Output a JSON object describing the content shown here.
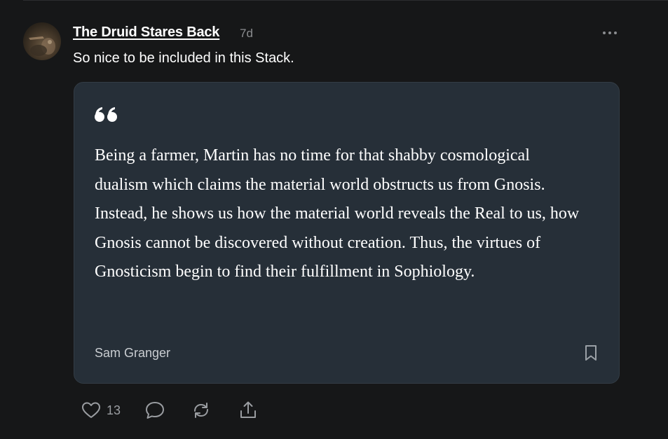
{
  "post": {
    "author": "The Druid Stares Back",
    "timestamp": "7d",
    "text": "So nice to be included in this Stack.",
    "avatar_icon": "avatar-image"
  },
  "quote": {
    "text": "Being a farmer, Martin has no time for that shabby cosmological dualism which claims the material world obstructs us from Gnosis. Instead, he shows us how the material world reveals the Real to us, how Gnosis cannot be discovered without creation. Thus, the virtues of Gnosticism begin to find their fulfillment in Sophiology.",
    "author": "Sam Granger"
  },
  "actions": {
    "like_count": "13",
    "icons": [
      "heart-icon",
      "comment-icon",
      "restack-icon",
      "share-icon"
    ]
  },
  "colors": {
    "background": "#161718",
    "card": "#262f38",
    "muted_text": "#8b8d90",
    "text": "#ffffff"
  }
}
